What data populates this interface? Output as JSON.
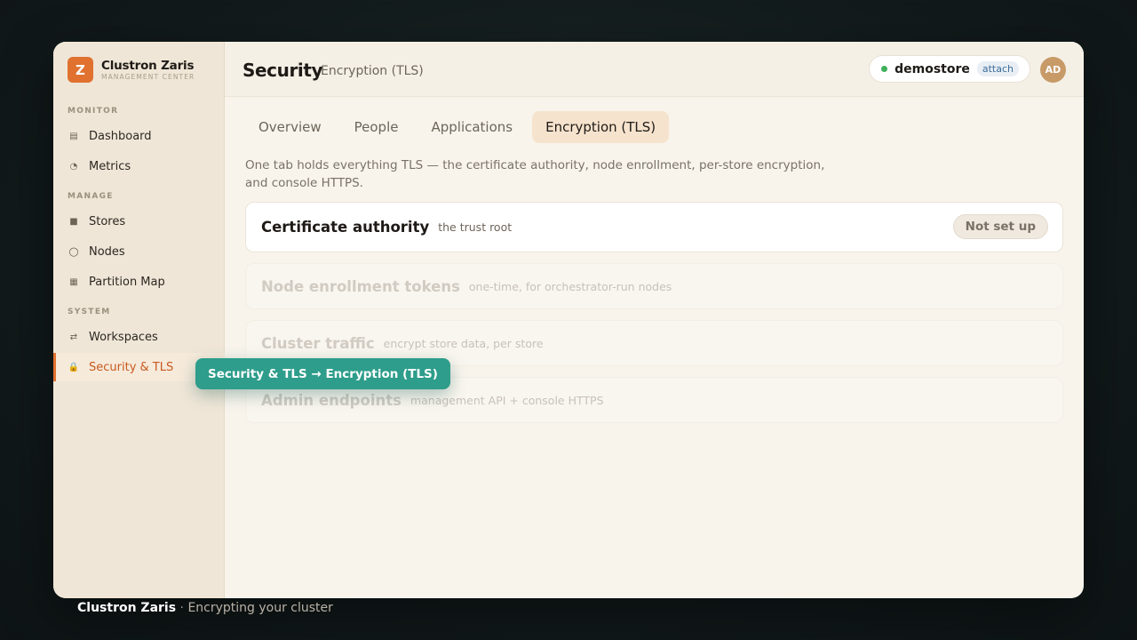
{
  "brand": {
    "name": "Clustron Zaris",
    "subtitle": "MANAGEMENT CENTER",
    "logo_letter": "Z"
  },
  "sidebar": {
    "sections": [
      {
        "label": "MONITOR",
        "items": [
          {
            "label": "Dashboard",
            "icon": "dashboard-icon"
          },
          {
            "label": "Metrics",
            "icon": "metrics-icon"
          }
        ]
      },
      {
        "label": "MANAGE",
        "items": [
          {
            "label": "Stores",
            "icon": "stores-icon"
          },
          {
            "label": "Nodes",
            "icon": "nodes-icon"
          },
          {
            "label": "Partition Map",
            "icon": "partition-map-icon"
          }
        ]
      },
      {
        "label": "SYSTEM",
        "items": [
          {
            "label": "Workspaces",
            "icon": "workspaces-icon"
          },
          {
            "label": "Security & TLS",
            "icon": "lock-icon",
            "active": true
          }
        ]
      }
    ]
  },
  "header": {
    "title": "Security",
    "subtitle": "Encryption (TLS)",
    "store": {
      "name": "demostore",
      "badge": "attach",
      "status_color": "#3fb05a"
    },
    "avatar": "AD"
  },
  "tabs": [
    {
      "label": "Overview"
    },
    {
      "label": "People"
    },
    {
      "label": "Applications"
    },
    {
      "label": "Encryption (TLS)",
      "active": true
    }
  ],
  "intro": "One tab holds everything TLS — the certificate authority, node enrollment, per-store encryption, and console HTTPS.",
  "cards": [
    {
      "title": "Certificate authority",
      "subtitle": "the trust root",
      "status": "Not set up"
    },
    {
      "title": "Node enrollment tokens",
      "subtitle": "one-time, for orchestrator-run nodes"
    },
    {
      "title": "Cluster traffic",
      "subtitle": "encrypt store data, per store"
    },
    {
      "title": "Admin endpoints",
      "subtitle": "management API + console HTTPS"
    }
  ],
  "tooltip": "Security & TLS → Encryption (TLS)",
  "caption": {
    "brand": "Clustron Zaris",
    "separator": "·",
    "text": "Encrypting your cluster"
  },
  "colors": {
    "accent": "#e0712f",
    "tooltip": "#2e9d8b",
    "active_text": "#c85a1f"
  }
}
